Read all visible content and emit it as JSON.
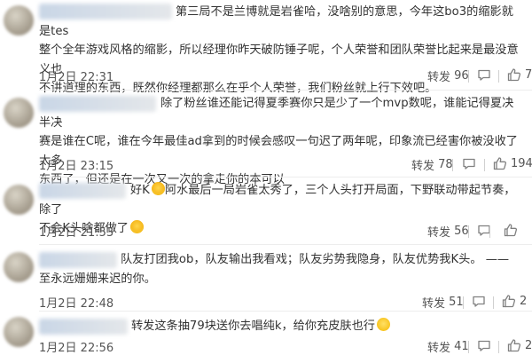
{
  "comments": [
    {
      "text_a": "第三局不是兰博就是岩雀哈，没啥别的意思，今年这bo3的缩影就是tes",
      "text_b": "整个全年游戏风格的缩影，所以经理你昨天破防锤子呢，个人荣誉和团队荣誉比起来是最没意义也",
      "text_c": "不讲道理的东西，既然你经理都那么在乎个人荣誉，我们粉丝就上行下效吧。",
      "time": "1月2日 22:31",
      "repost_label": "转发",
      "repost_count": "96",
      "comment_count": "",
      "like_count": "7"
    },
    {
      "text_a": "除了粉丝谁还能记得夏季赛你只是少了一个mvp数呢，谁能记得夏决半决",
      "text_b": "赛是谁在C呢，谁在今年最佳ad拿到的时候会感叹一句迟了两年呢，印象流已经害你被没收了太多",
      "text_c": "东西了，但还是在一次又一次的拿走你的本可以",
      "time": "1月2日 23:15",
      "repost_label": "转发",
      "repost_count": "78",
      "comment_count": "",
      "like_count": "194"
    },
    {
      "text_a": "好K",
      "text_b": "阿水最后一局岩雀太秀了，三个人头打开局面，下野联动带起节奏，除了",
      "text_c": "不会K头啥都做了",
      "time": "1月2日 21:53",
      "repost_label": "转发",
      "repost_count": "56",
      "comment_count": "",
      "like_count": ""
    },
    {
      "text_a": "队友打团我ob，队友输出我看戏；队友劣势我隐身，队友优势我K头。 ——",
      "text_b": "至永远姗姗来迟的你。",
      "time": "1月2日 22:48",
      "repost_label": "转发",
      "repost_count": "51",
      "comment_count": "",
      "like_count": "2"
    },
    {
      "text_a": "转发这条抽79块送你去唱纯k，给你充皮肤也行",
      "time": "1月2日 22:56",
      "repost_label": "转发",
      "repost_count": "41",
      "comment_count": "",
      "like_count": "2"
    }
  ],
  "icons": {
    "repost": "repost-icon",
    "comment": "comment-icon",
    "like": "like-icon",
    "emoji_cry": "crying-laugh-emoji-icon",
    "emoji_smile": "smile-emoji-icon"
  }
}
